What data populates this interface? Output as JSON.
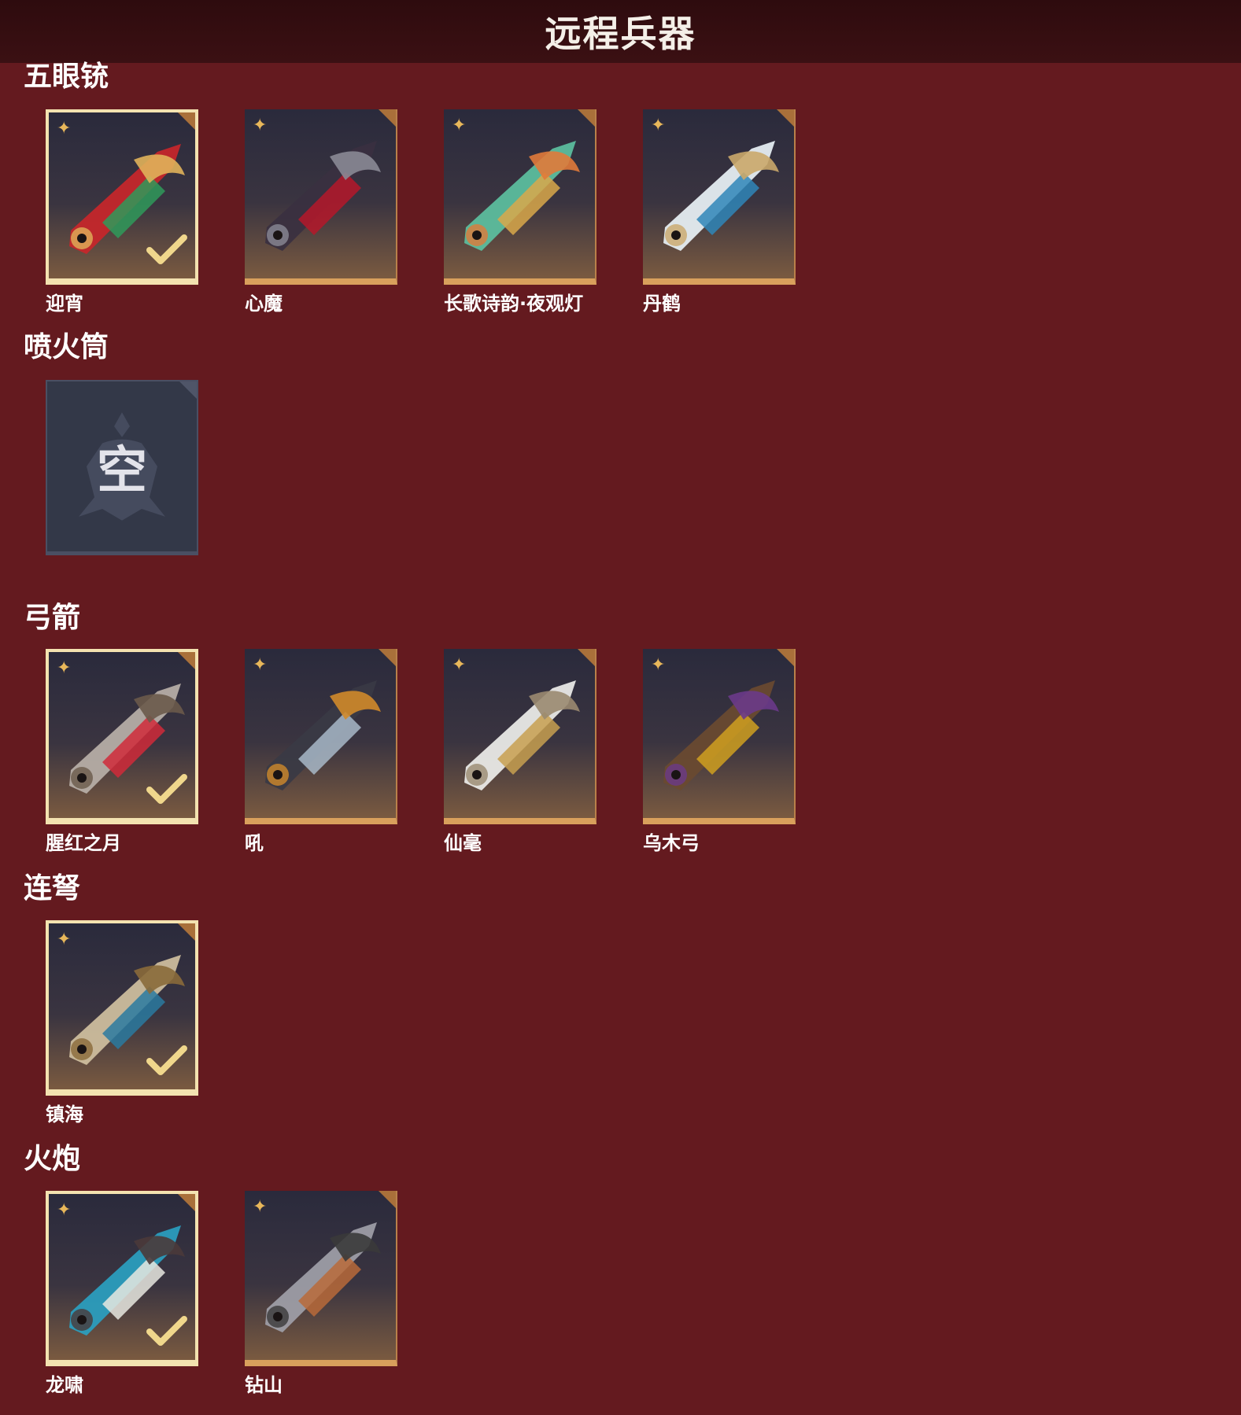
{
  "header": {
    "title": "远程兵器"
  },
  "sections": [
    {
      "title": "五眼铳",
      "items": [
        {
          "name": "迎宵",
          "equipped": true,
          "colors": [
            "#c8262a",
            "#2f9a5a",
            "#e0b25a"
          ]
        },
        {
          "name": "心魔",
          "equipped": false,
          "colors": [
            "#3a3040",
            "#b5182a",
            "#8a8a95"
          ]
        },
        {
          "name": "长歌诗韵·夜观灯",
          "equipped": false,
          "colors": [
            "#5cc0a0",
            "#d9a84a",
            "#e07a3a"
          ]
        },
        {
          "name": "丹鹤",
          "equipped": false,
          "colors": [
            "#e9f2f6",
            "#2f86b8",
            "#caa86a"
          ]
        }
      ]
    },
    {
      "title": "喷火筒",
      "items": [
        {
          "name": "",
          "empty": true,
          "empty_text": "空"
        }
      ]
    },
    {
      "title": "弓箭",
      "items": [
        {
          "name": "腥红之月",
          "equipped": true,
          "colors": [
            "#b8b0a8",
            "#d02a3a",
            "#6a5a4a"
          ]
        },
        {
          "name": "吼",
          "equipped": false,
          "colors": [
            "#3a3a44",
            "#a8b8c8",
            "#d08a2a"
          ]
        },
        {
          "name": "仙毫",
          "equipped": false,
          "colors": [
            "#eeeeea",
            "#c8a050",
            "#9a8a70"
          ]
        },
        {
          "name": "乌木弓",
          "equipped": false,
          "colors": [
            "#6a4a30",
            "#d0a020",
            "#6a3a8a"
          ]
        }
      ]
    },
    {
      "title": "连弩",
      "items": [
        {
          "name": "镇海",
          "equipped": true,
          "colors": [
            "#d0c0a0",
            "#2a7aa0",
            "#8a6a3a"
          ]
        }
      ]
    },
    {
      "title": "火炮",
      "items": [
        {
          "name": "龙啸",
          "equipped": true,
          "colors": [
            "#2aa0c0",
            "#e8e8e0",
            "#4a3a3a"
          ]
        },
        {
          "name": "钻山",
          "equipped": false,
          "colors": [
            "#a0a0a8",
            "#b86a3a",
            "#3a3a3a"
          ]
        }
      ]
    }
  ]
}
